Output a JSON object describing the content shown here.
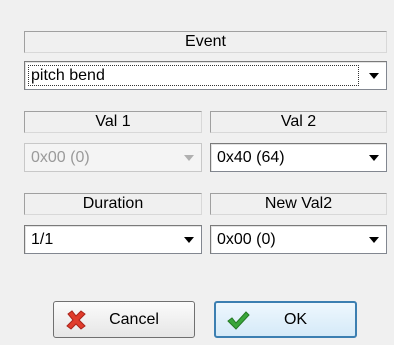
{
  "event": {
    "header": "Event",
    "selected": "pitch bend"
  },
  "val1": {
    "header": "Val 1",
    "selected": "0x00  (0)",
    "disabled": true
  },
  "val2": {
    "header": "Val 2",
    "selected": "0x40  (64)"
  },
  "duration": {
    "header": "Duration",
    "selected": "1/1"
  },
  "new_val2": {
    "header": "New Val2",
    "selected": "0x00  (0)"
  },
  "buttons": {
    "cancel_label": "Cancel",
    "ok_label": "OK"
  },
  "icons": {
    "cancel": "red-x-icon",
    "ok": "green-check-icon",
    "dropdown": "chevron-down-icon"
  },
  "colors": {
    "cancel_icon": "#e03c2c",
    "ok_icon": "#3aa63a",
    "default_button_border": "#3c7fb1",
    "disabled_text": "#9a9a9a"
  }
}
